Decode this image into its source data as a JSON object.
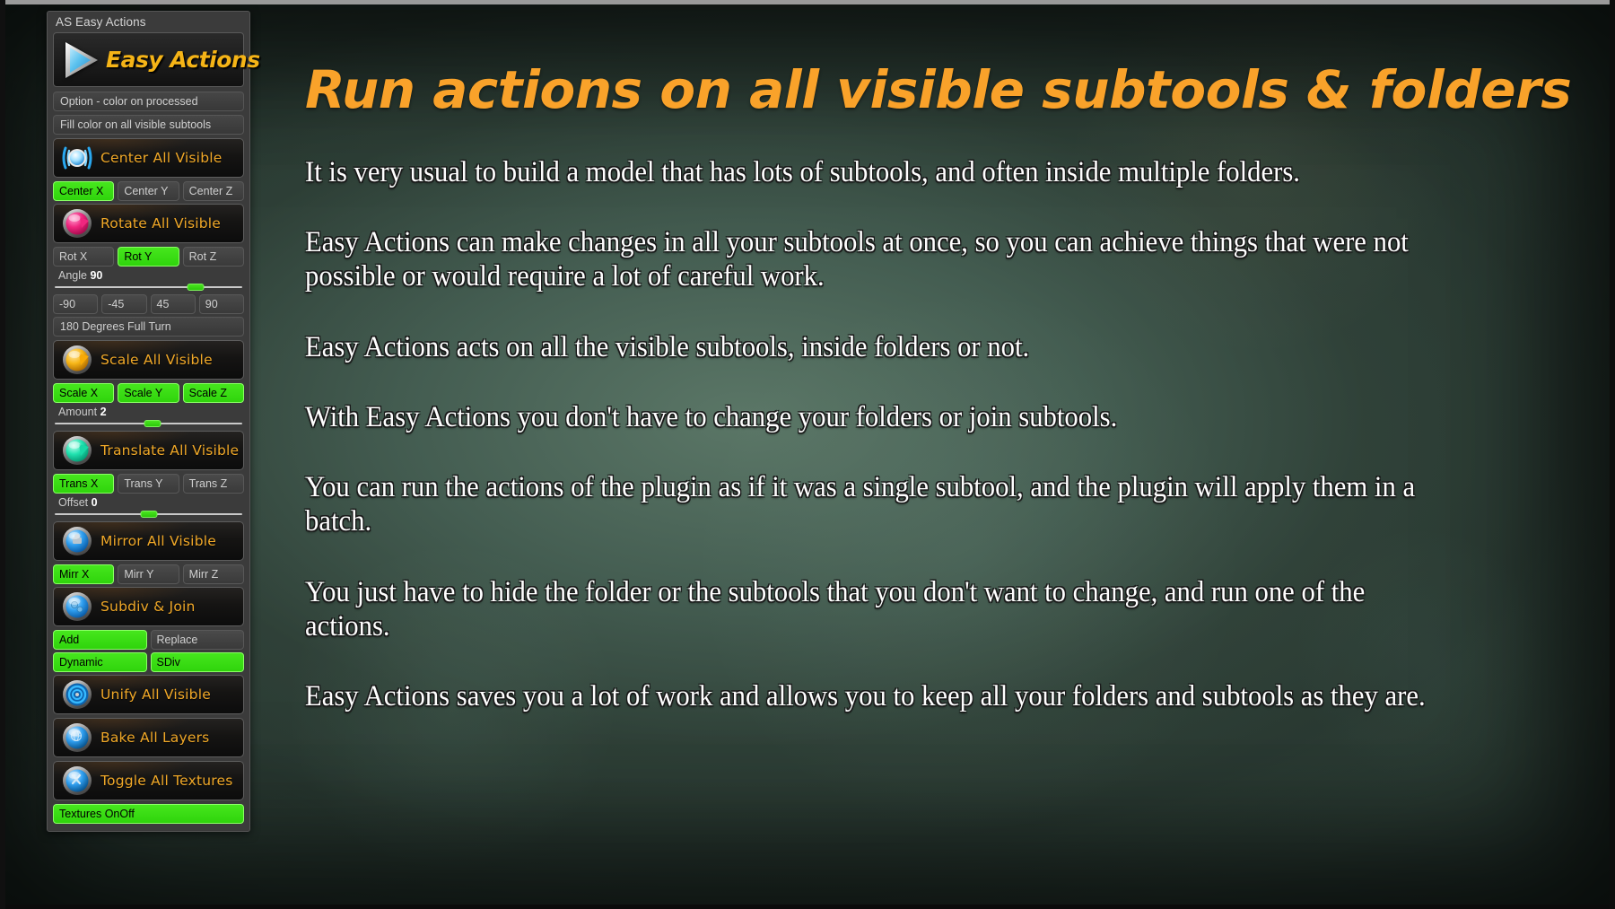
{
  "window": {
    "panel_title": "AS Easy Actions"
  },
  "panel": {
    "logo": {
      "icon": "play-triangle-icon",
      "text": "Easy Actions"
    },
    "option_label": "Option - color on processed",
    "fill_color_button": "Fill color on all visible subtools",
    "groups": [
      {
        "action": {
          "label": "Center All Visible",
          "icon": "center-target-icon"
        },
        "toggles": [
          {
            "label": "Center X",
            "active": true
          },
          {
            "label": "Center Y",
            "active": false
          },
          {
            "label": "Center Z",
            "active": false
          }
        ]
      },
      {
        "action": {
          "label": "Rotate All Visible",
          "icon": "rotate-sphere-icon"
        },
        "toggles": [
          {
            "label": "Rot X",
            "active": false
          },
          {
            "label": "Rot Y",
            "active": true
          },
          {
            "label": "Rot Z",
            "active": false
          }
        ],
        "slider": {
          "label": "Angle",
          "value": "90",
          "percent": 75
        },
        "presets": [
          "-90",
          "-45",
          "45",
          "90"
        ],
        "full_turn_label": "180 Degrees Full Turn"
      },
      {
        "action": {
          "label": "Scale All Visible",
          "icon": "scale-sphere-icon"
        },
        "toggles": [
          {
            "label": "Scale X",
            "active": true
          },
          {
            "label": "Scale Y",
            "active": true
          },
          {
            "label": "Scale Z",
            "active": true
          }
        ],
        "slider": {
          "label": "Amount",
          "value": "2",
          "percent": 52
        }
      },
      {
        "action": {
          "label": "Translate All Visible",
          "icon": "translate-sphere-icon"
        },
        "toggles": [
          {
            "label": "Trans X",
            "active": true
          },
          {
            "label": "Trans Y",
            "active": false
          },
          {
            "label": "Trans Z",
            "active": false
          }
        ],
        "slider": {
          "label": "Offset",
          "value": "0",
          "percent": 50
        }
      },
      {
        "action": {
          "label": "Mirror All Visible",
          "icon": "mirror-sphere-icon"
        },
        "toggles": [
          {
            "label": "Mirr X",
            "active": true
          },
          {
            "label": "Mirr Y",
            "active": false
          },
          {
            "label": "Mirr Z",
            "active": false
          }
        ]
      },
      {
        "action": {
          "label": "Subdiv & Join",
          "icon": "gear-sphere-icon"
        },
        "pairs": [
          [
            {
              "label": "Add",
              "active": true
            },
            {
              "label": "Replace",
              "active": false
            }
          ],
          [
            {
              "label": "Dynamic",
              "active": true
            },
            {
              "label": "SDiv",
              "active": true
            }
          ]
        ]
      },
      {
        "action": {
          "label": "Unify All Visible",
          "icon": "unify-sphere-icon"
        }
      },
      {
        "action": {
          "label": "Bake All Layers",
          "icon": "bake-sphere-icon"
        }
      },
      {
        "action": {
          "label": "Toggle All Textures",
          "icon": "texture-sphere-icon"
        },
        "footer_toggle": {
          "label": "Textures OnOff",
          "active": true
        }
      }
    ]
  },
  "main": {
    "headline": "Run actions on all visible subtools & folders",
    "paragraphs": [
      "It is very usual to build a model that has lots of subtools, and often inside multiple folders.",
      "Easy Actions can make changes in all your subtools at once, so you can achieve things that were not possible or would require a lot of careful work.",
      "Easy Actions acts on all the visible subtools, inside folders or not.",
      "With Easy Actions you don't have to change your folders or join subtools.",
      "You can run the actions of the plugin as if it was a single subtool, and the plugin will apply them in a batch.",
      "You just have to hide the folder or the subtools that you don't want to change, and run one of the actions.",
      "Easy Actions saves you a lot of work and allows you to keep all your folders and subtools as they are."
    ]
  },
  "colors": {
    "accent_orange": "#f9a22a",
    "logo_yellow": "#f5b417",
    "active_green": "#3ddc14",
    "panel_gray": "#3b3b3b",
    "text_white": "#ffffff"
  }
}
